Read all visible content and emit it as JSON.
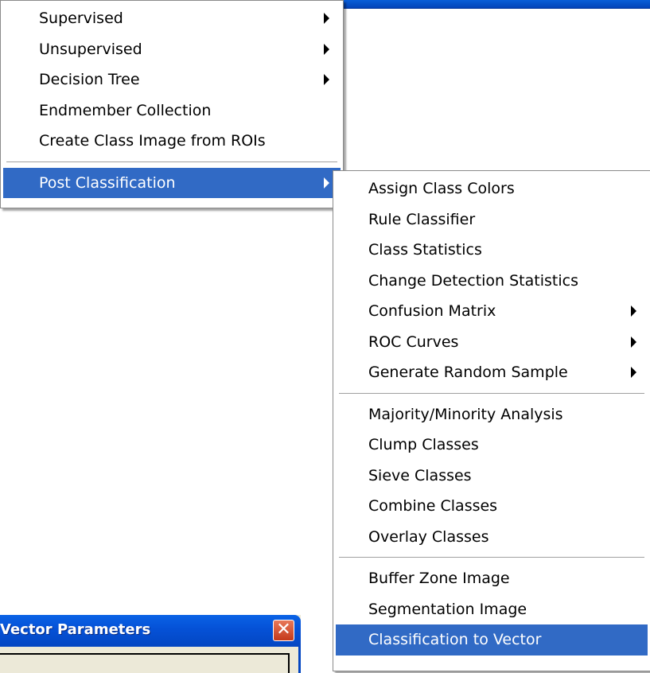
{
  "main_menu": {
    "items": [
      {
        "label": "Supervised",
        "has_submenu": true
      },
      {
        "label": "Unsupervised",
        "has_submenu": true
      },
      {
        "label": "Decision Tree",
        "has_submenu": true
      },
      {
        "label": "Endmember Collection",
        "has_submenu": false
      },
      {
        "label": "Create Class Image from ROIs",
        "has_submenu": false
      }
    ],
    "post_classification": {
      "label": "Post Classification",
      "has_submenu": true,
      "highlighted": true
    }
  },
  "post_classification_menu": {
    "group1": [
      {
        "label": "Assign Class Colors"
      },
      {
        "label": "Rule Classifier"
      },
      {
        "label": "Class Statistics"
      },
      {
        "label": "Change Detection Statistics"
      },
      {
        "label": "Confusion Matrix"
      },
      {
        "label": "ROC Curves"
      },
      {
        "label": "Generate Random Sample"
      }
    ],
    "group2": [
      {
        "label": "Majority/Minority Analysis"
      },
      {
        "label": "Clump Classes"
      },
      {
        "label": "Sieve Classes"
      },
      {
        "label": "Combine Classes"
      },
      {
        "label": "Overlay Classes"
      }
    ],
    "group3": [
      {
        "label": "Buffer Zone Image"
      },
      {
        "label": "Segmentation Image"
      },
      {
        "label": "Classification to Vector"
      }
    ]
  },
  "dialog": {
    "title": "Vector Parameters",
    "close_symbol": "✕"
  },
  "colors": {
    "highlight": "#316ac5",
    "titlebar": "#0551d6",
    "close_button": "#d9542f"
  }
}
